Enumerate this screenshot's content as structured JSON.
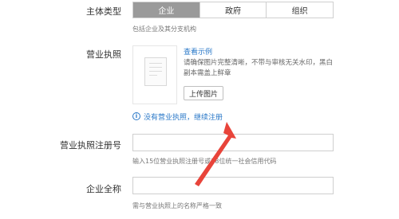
{
  "subject_type": {
    "label": "主体类型",
    "options": [
      "企业",
      "政府",
      "组织"
    ],
    "selected": "企业",
    "hint": "包括企业及其分支机构"
  },
  "business_license": {
    "label": "营业执照",
    "view_example": "查看示例",
    "desc_line1": "请确保图片完整清晰，不带与审核无关水印，黑白",
    "desc_line2": "副本需盖上鲜章",
    "upload_button": "上传图片",
    "notice": "没有营业执照，继续注册"
  },
  "registration_number": {
    "label": "营业执照注册号",
    "value": "",
    "hint": "输入15位营业执照注册号或18位统一社会信用代码"
  },
  "company_name": {
    "label": "企业全称",
    "value": "",
    "hint": "需与营业执照上的名称严格一致"
  },
  "colors": {
    "accent_link": "#2a78c8",
    "arrow": "#e8443a",
    "selected_segment": "#9a9a9a"
  }
}
